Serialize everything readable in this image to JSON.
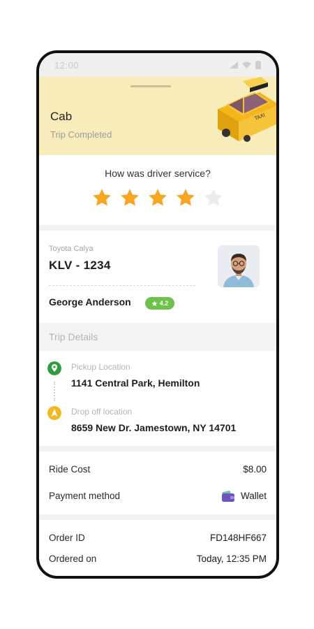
{
  "status_bar": {
    "time": "12:00"
  },
  "header": {
    "title": "Cab",
    "subtitle": "Trip Completed"
  },
  "rating": {
    "question": "How was driver service?",
    "stars_filled": 4,
    "stars_total": 5,
    "star_color": "#f6a623"
  },
  "driver": {
    "car_model": "Toyota Calya",
    "plate": "KLV -  1234",
    "name": "George Anderson",
    "rating": "4.2"
  },
  "trip": {
    "section_title": "Trip Details",
    "pickup_label": "Pickup Location",
    "pickup_value": "1141 Central Park, Hemilton",
    "dropoff_label": "Drop off location",
    "dropoff_value": "8659 New Dr. Jamestown, NY 14701"
  },
  "payment": {
    "ride_cost_label": "Ride Cost",
    "ride_cost_value": "$8.00",
    "method_label": "Payment method",
    "method_value": "Wallet"
  },
  "order": {
    "id_label": "Order ID",
    "id_value": "FD148HF667",
    "date_label": "Ordered on",
    "date_value": "Today, 12:35 PM"
  },
  "colors": {
    "header_bg": "#f9ecbb",
    "accent_green": "#2e9d3f",
    "accent_yellow": "#f2b822",
    "badge_green": "#6cc24a"
  }
}
